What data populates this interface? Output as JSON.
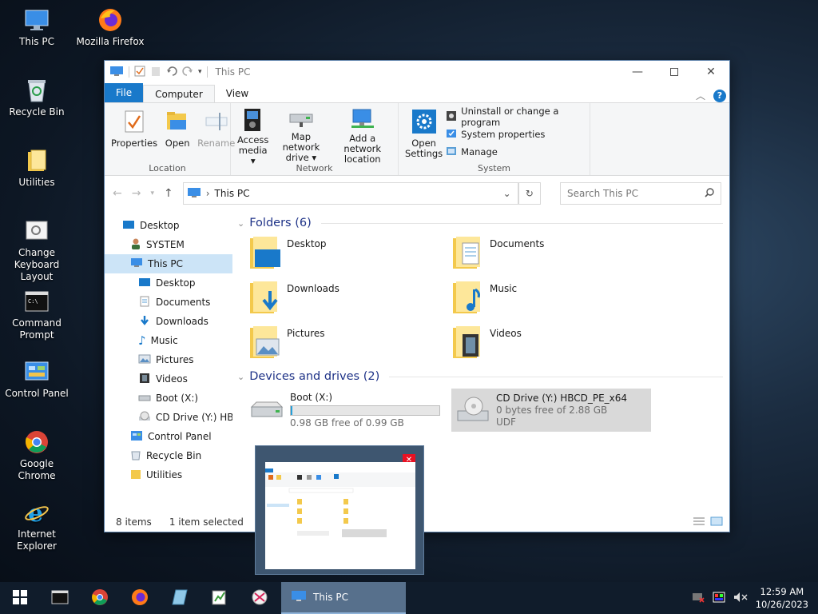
{
  "desktop": {
    "icons": [
      {
        "label": "This PC",
        "icon": "monitor-icon"
      },
      {
        "label": "Mozilla Firefox",
        "icon": "firefox-icon"
      },
      {
        "label": "Recycle Bin",
        "icon": "recycle-bin-icon"
      },
      {
        "label": "Utilities",
        "icon": "folder-icon"
      },
      {
        "label": "Change Keyboard Layout",
        "icon": "keyboard-settings-icon"
      },
      {
        "label": "Command Prompt",
        "icon": "terminal-icon"
      },
      {
        "label": "Control Panel",
        "icon": "control-panel-icon"
      },
      {
        "label": "Google Chrome",
        "icon": "chrome-icon"
      },
      {
        "label": "Internet Explorer",
        "icon": "ie-icon"
      }
    ]
  },
  "window": {
    "title": "This PC",
    "tabs": [
      "File",
      "Computer",
      "View"
    ],
    "ribbon": {
      "location": {
        "label": "Location",
        "buttons": [
          {
            "l1": "Properties",
            "l2": ""
          },
          {
            "l1": "Open",
            "l2": ""
          },
          {
            "l1": "Rename",
            "l2": ""
          }
        ]
      },
      "network": {
        "label": "Network",
        "buttons": [
          {
            "l1": "Access",
            "l2": "media ▾"
          },
          {
            "l1": "Map network",
            "l2": "drive ▾"
          },
          {
            "l1": "Add a network",
            "l2": "location"
          }
        ]
      },
      "system": {
        "label": "System",
        "open_l1": "Open",
        "open_l2": "Settings",
        "items": [
          "Uninstall or change a program",
          "System properties",
          "Manage"
        ]
      }
    },
    "address": {
      "crumb": "This PC",
      "search_placeholder": "Search This PC"
    },
    "nav_items": [
      "Desktop",
      "SYSTEM",
      "This PC",
      "Desktop",
      "Documents",
      "Downloads",
      "Music",
      "Pictures",
      "Videos",
      "Boot (X:)",
      "CD Drive (Y:) HBC",
      "Control Panel",
      "Recycle Bin",
      "Utilities"
    ],
    "folders_header": "Folders (6)",
    "folders": [
      "Desktop",
      "Documents",
      "Downloads",
      "Music",
      "Pictures",
      "Videos"
    ],
    "drives_header": "Devices and drives (2)",
    "drives": [
      {
        "name": "Boot (X:)",
        "info": "0.98 GB free of 0.99 GB",
        "used_fraction": 0.01
      },
      {
        "name": "CD Drive (Y:) HBCD_PE_x64",
        "info": "0 bytes free of 2.88 GB",
        "fs": "UDF"
      }
    ],
    "status": {
      "count": "8 items",
      "selected": "1 item selected"
    }
  },
  "taskbar": {
    "active_item": "This PC",
    "time": "12:59 AM",
    "date": "10/26/2023"
  },
  "colors": {
    "accent": "#1979ca",
    "selection": "#cce4f7",
    "folder": "#f3c94c"
  }
}
